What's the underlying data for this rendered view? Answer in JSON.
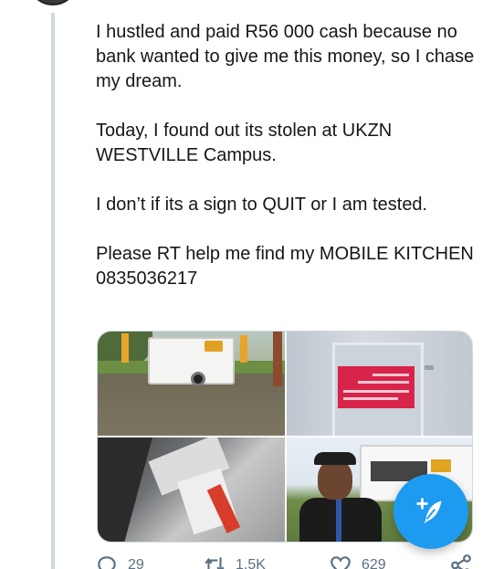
{
  "tweet": {
    "paragraphs": [
      "I hustled and paid R56 000 cash because no bank wanted to give me this money, so I chase my dream.",
      "Today, I found out its stolen at UKZN WESTVILLE Campus.",
      "I don’t if its a sign to QUIT or I am tested.",
      "Please RT help me find my MOBILE KITCHEN\n0835036217"
    ]
  },
  "media": {
    "images": [
      {
        "icon": "trailer-photo"
      },
      {
        "icon": "trailer-sign-photo",
        "sign_title": "CONTACT US"
      },
      {
        "icon": "kitchen-interior-photo"
      },
      {
        "icon": "owner-with-trailer-photo"
      }
    ]
  },
  "actions": {
    "reply_count": "29",
    "retweet_count": "1.5K",
    "like_count": "629"
  },
  "colors": {
    "accent": "#1d9bf0",
    "text": "#14171a",
    "muted": "#5b7083",
    "thread_line": "#cfd9de"
  }
}
